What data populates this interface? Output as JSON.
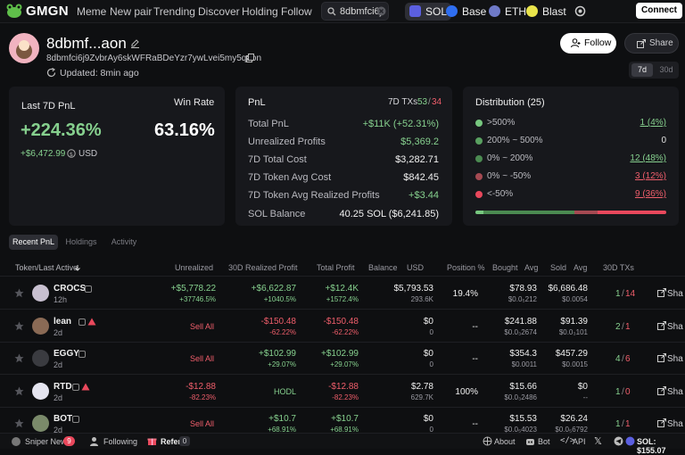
{
  "header": {
    "logo": "GMGN",
    "nav": [
      "Meme",
      "New pair",
      "Trending",
      "Discover",
      "Holding",
      "Follow"
    ],
    "search_value": "8dbmfci6j",
    "chains": [
      {
        "label": "SOL",
        "color": "#5b5fe0"
      },
      {
        "label": "Base",
        "color": "#2f6ef0"
      },
      {
        "label": "ETH",
        "color": "#6f7ac8"
      },
      {
        "label": "Blast",
        "color": "#e9e44b"
      }
    ],
    "connect_label": "Connect"
  },
  "profile": {
    "name": "8dbmf...aon",
    "address": "8dbmfci6j9ZvbrAy6skWFRaBDeYzr7ywLvei5my5qaon",
    "updated": "Updated: 8min ago",
    "follow_label": "Follow",
    "share_label": "Share",
    "periods": [
      "7d",
      "30d"
    ]
  },
  "summary": {
    "pnl_title": "Last 7D PnL",
    "pnl_pct": "+224.36%",
    "pnl_usd": "+$6,472.99",
    "pnl_currency": "USD",
    "win_rate_label": "Win Rate",
    "win_rate": "63.16%"
  },
  "pnl_card": {
    "title": "PnL",
    "txs_label": "7D TXs",
    "txs_win": "53",
    "txs_sep": "/",
    "txs_loss": "34",
    "rows": [
      {
        "label": "Total PnL",
        "value": "+$11K (+52.31%)"
      },
      {
        "label": "Unrealized Profits",
        "value": "$5,369.2"
      },
      {
        "label": "7D Total Cost",
        "value": "$3,282.71"
      },
      {
        "label": "7D Token Avg Cost",
        "value": "$842.45"
      },
      {
        "label": "7D Token Avg Realized Profits",
        "value": "+$3.44"
      }
    ],
    "balance_label": "SOL Balance",
    "balance_value": "40.25 SOL ($6,241.85)"
  },
  "distribution": {
    "title": "Distribution (25)",
    "rows": [
      {
        "label": ">500%",
        "value": "1 (4%)",
        "color": "#77c77f"
      },
      {
        "label": "200% ~ 500%",
        "value": "0",
        "color": "#59a060"
      },
      {
        "label": "0% ~ 200%",
        "value": "12 (48%)",
        "color": "#4b8a51"
      },
      {
        "label": "0% ~ -50%",
        "value": "3 (12%)",
        "color": "#a54a52"
      },
      {
        "label": "<-50%",
        "value": "9 (36%)",
        "color": "#e9485c"
      }
    ],
    "bar_shares": [
      0.04,
      0.0,
      0.48,
      0.12,
      0.36
    ]
  },
  "tabs": [
    "Recent PnL",
    "Holdings",
    "Activity"
  ],
  "table": {
    "headers": [
      "Token/Last Active",
      "Unrealized",
      "30D Realized Profit",
      "Total Profit",
      "Balance",
      "USD",
      "Position %",
      "Bought",
      "Avg",
      "Sold",
      "Avg",
      "30D TXs"
    ],
    "rows": [
      {
        "name": "CROCS",
        "time": "12h",
        "unreal": "+$5,778.22",
        "unreal_pct": "+37746.5%",
        "realized": "+$6,622.87",
        "realized_pct": "+1040.5%",
        "total": "+$12.4K",
        "total_pct": "+1572.4%",
        "balance": "$5,793.53",
        "balance_sub": "293.6K",
        "position": "19.4%",
        "bought": "$78.93",
        "bought_avg": "$0.0₅212",
        "sold": "$6,686.48",
        "sold_avg": "$0.0054",
        "tx_buy": "1",
        "tx_sell": "14",
        "action": ""
      },
      {
        "name": "lean",
        "time": "2d",
        "unreal": "",
        "unreal_pct": "",
        "realized": "-$150.48",
        "realized_pct": "-62.22%",
        "total": "-$150.48",
        "total_pct": "-62.22%",
        "balance": "$0",
        "balance_sub": "0",
        "position": "--",
        "bought": "$241.88",
        "bought_avg": "$0.0₃2674",
        "sold": "$91.39",
        "sold_avg": "$0.0₃101",
        "tx_buy": "2",
        "tx_sell": "1",
        "action": "Sell All"
      },
      {
        "name": "EGGY",
        "time": "2d",
        "unreal": "",
        "unreal_pct": "",
        "realized": "+$102.99",
        "realized_pct": "+29.07%",
        "total": "+$102.99",
        "total_pct": "+29.07%",
        "balance": "$0",
        "balance_sub": "0",
        "position": "--",
        "bought": "$354.3",
        "bought_avg": "$0.0011",
        "sold": "$457.29",
        "sold_avg": "$0.0015",
        "tx_buy": "4",
        "tx_sell": "6",
        "action": "Sell All"
      },
      {
        "name": "RTD",
        "time": "2d",
        "unreal": "-$12.88",
        "unreal_pct": "-82.23%",
        "realized": "HODL",
        "realized_pct": "",
        "total": "-$12.88",
        "total_pct": "-82.23%",
        "balance": "$2.78",
        "balance_sub": "629.7K",
        "position": "100%",
        "bought": "$15.66",
        "bought_avg": "$0.0₃2486",
        "sold": "$0",
        "sold_avg": "--",
        "tx_buy": "1",
        "tx_sell": "0",
        "action": ""
      },
      {
        "name": "BOT",
        "time": "2d",
        "unreal": "",
        "unreal_pct": "",
        "realized": "+$10.7",
        "realized_pct": "+68.91%",
        "total": "+$10.7",
        "total_pct": "+68.91%",
        "balance": "$0",
        "balance_sub": "0",
        "position": "--",
        "bought": "$15.53",
        "bought_avg": "$0.0₅4023",
        "sold": "$26.24",
        "sold_avg": "$0.0₅6792",
        "tx_buy": "1",
        "tx_sell": "1",
        "action": "Sell All"
      }
    ],
    "share_label": "Sha"
  },
  "bottom": {
    "sniper": "Sniper New",
    "sniper_count": "9",
    "following": "Following",
    "refer": "Refer",
    "refer_count": "0",
    "about": "About",
    "bot": "Bot",
    "api": "API",
    "sol_price": "SOL: $155.07"
  }
}
